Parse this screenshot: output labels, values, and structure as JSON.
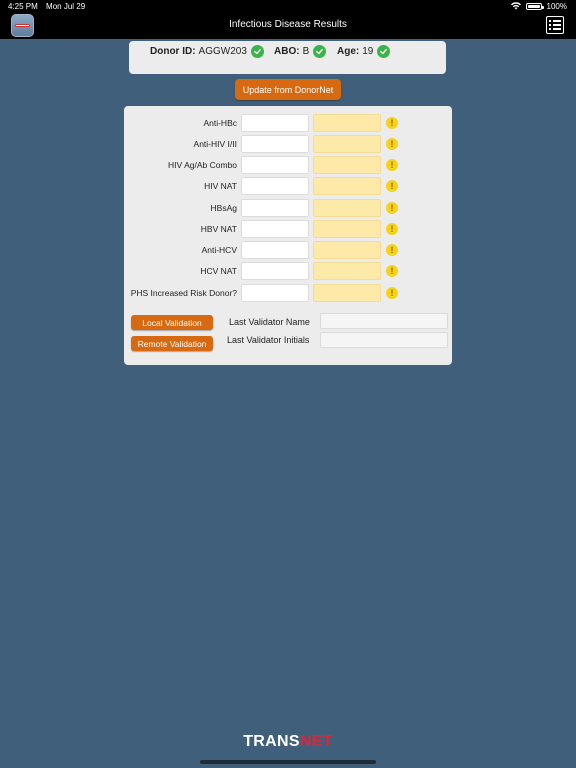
{
  "status_bar": {
    "time": "4:25 PM",
    "date": "Mon Jul 29",
    "battery_percent": "100%",
    "battery_level": 1.0
  },
  "nav": {
    "title": "Infectious Disease Results",
    "app_icon": "transnet-app-icon",
    "menu_icon": "list-icon"
  },
  "donor": {
    "id_label": "Donor ID:",
    "id_value": "AGGW203",
    "abo_label": "ABO:",
    "abo_value": "B",
    "age_label": "Age:",
    "age_value": "19",
    "check_color": "#3bb34a"
  },
  "update_button": "Update from DonorNet",
  "tests": [
    {
      "label": "Anti-HBc"
    },
    {
      "label": "Anti-HIV I/II"
    },
    {
      "label": "HIV Ag/Ab Combo"
    },
    {
      "label": "HIV NAT"
    },
    {
      "label": "HBsAg"
    },
    {
      "label": "HBV NAT"
    },
    {
      "label": "Anti-HCV"
    },
    {
      "label": "HCV NAT"
    },
    {
      "label": "PHS Increased Risk Donor?"
    }
  ],
  "warning_glyph": "!",
  "validation": {
    "local_button": "Local Validation",
    "remote_button": "Remote Validation",
    "name_label": "Last Validator Name",
    "initials_label": "Last Validator Initials"
  },
  "footer": {
    "logo_part1": "TRANS",
    "logo_part2": "NET"
  },
  "colors": {
    "background": "#3f5f7a",
    "accent_orange": "#d76a10",
    "result_field": "#fde9a8",
    "warning": "#f6d31a",
    "logo_red": "#e0243b"
  }
}
